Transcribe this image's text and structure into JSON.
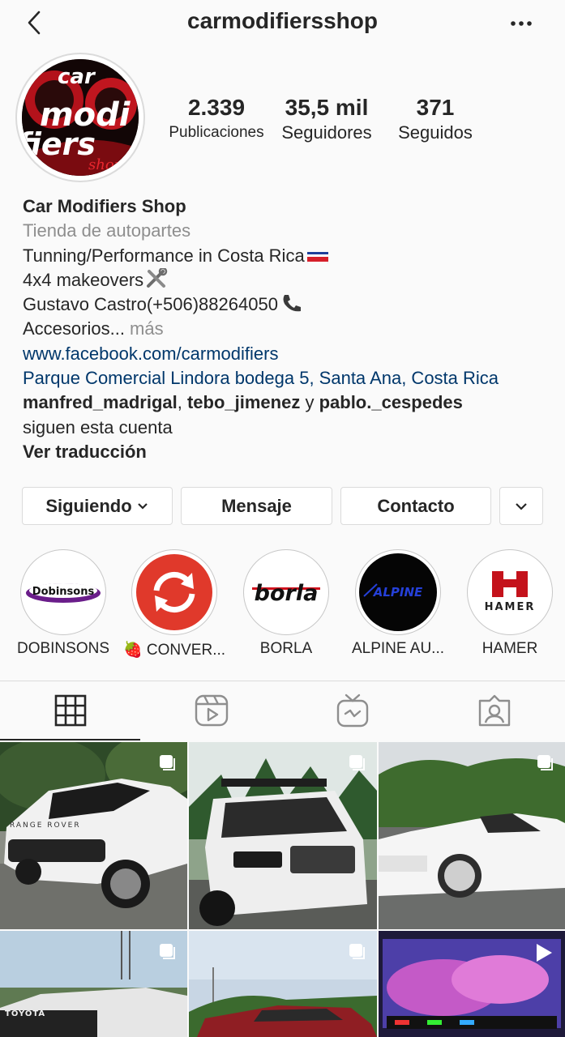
{
  "header": {
    "username": "carmodifiersshop"
  },
  "avatar": {
    "logo_line1": "car",
    "logo_line2": "modi",
    "logo_line3": "fiers",
    "logo_line4": "shop"
  },
  "stats": [
    {
      "value": "2.339",
      "label": "Publicaciones"
    },
    {
      "value": "35,5 mil",
      "label": "Seguidores"
    },
    {
      "value": "371",
      "label": "Seguidos"
    }
  ],
  "bio": {
    "name": "Car Modifiers Shop",
    "category": "Tienda de autopartes",
    "line1": "Tunning/Performance in Costa Rica",
    "line2": "4x4 makeovers",
    "line3": "Gustavo Castro(+506)88264050",
    "line4": "Accesorios...",
    "more": " más",
    "website": "www.facebook.com/carmodifiers",
    "address": "Parque Comercial Lindora bodega 5, Santa Ana, Costa Rica",
    "followed_by_1": "manfred_madrigal",
    "sep1": ", ",
    "followed_by_2": "tebo_jimenez",
    "sep2": " y ",
    "followed_by_3": "pablo._cespedes",
    "followed_suffix": "siguen esta cuenta",
    "translate": "Ver traducción"
  },
  "buttons": {
    "following": "Siguiendo",
    "message": "Mensaje",
    "contact": "Contacto"
  },
  "highlights": [
    {
      "label": "DOBINSONS",
      "logo": "Dobinsons"
    },
    {
      "label": "🍓 CONVER...",
      "logo": ""
    },
    {
      "label": "BORLA",
      "logo": "borla"
    },
    {
      "label": "ALPINE AU...",
      "logo": "ALPINE"
    },
    {
      "label": "HAMER",
      "logo": "HAMER"
    }
  ],
  "tabs": [
    "grid-icon",
    "reels-icon",
    "igtv-icon",
    "tagged-icon"
  ],
  "grid": [
    {
      "caption": "RANGE ROVER",
      "type": "carousel"
    },
    {
      "caption": "",
      "type": "carousel"
    },
    {
      "caption": "",
      "type": "carousel"
    },
    {
      "caption": "TOYOTA",
      "type": "carousel"
    },
    {
      "caption": "",
      "type": "carousel"
    },
    {
      "caption": "",
      "type": "video"
    }
  ],
  "colors": {
    "link": "#00376b",
    "secondary": "#8e8e8e",
    "border": "#dbdbdb",
    "accent": "#e0392b"
  }
}
